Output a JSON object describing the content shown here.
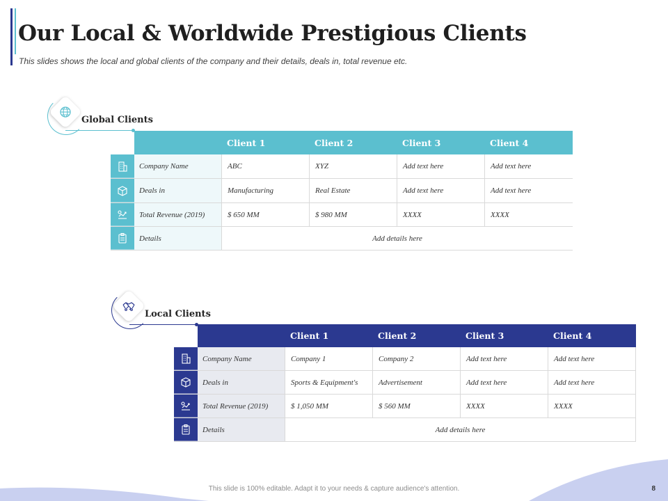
{
  "page": {
    "title": "Our Local  & Worldwide Prestigious Clients",
    "subtitle": "This slides shows  the local and global clients of the company  and their details, deals in, total revenue  etc."
  },
  "colors": {
    "global_accent": "#5bbfcf",
    "global_label_bg": "#eef8fa",
    "local_accent": "#2b3990",
    "local_label_bg": "#e8eaf0"
  },
  "global": {
    "title": "Global Clients",
    "icon": "globe-icon",
    "headers": [
      "Client 1",
      "Client 2",
      "Client 3",
      "Client 4"
    ],
    "rows": [
      {
        "icon": "building-icon",
        "label": "Company Name",
        "values": [
          "ABC",
          "XYZ",
          "Add text here",
          "Add text here"
        ]
      },
      {
        "icon": "box-icon",
        "label": "Deals in",
        "values": [
          "Manufacturing",
          "Real Estate",
          "Add text here",
          "Add text here"
        ]
      },
      {
        "icon": "revenue-chart-icon",
        "label": "Total Revenue  (2019)",
        "values": [
          "$ 650  MM",
          "$ 980  MM",
          "XXXX",
          "XXXX"
        ]
      }
    ],
    "details": {
      "icon": "clipboard-icon",
      "label": "Details",
      "value": "Add details here"
    }
  },
  "local": {
    "title": "Local Clients",
    "icon": "handshake-icon",
    "headers": [
      "Client 1",
      "Client 2",
      "Client 3",
      "Client 4"
    ],
    "rows": [
      {
        "icon": "building-icon",
        "label": "Company Name",
        "values": [
          "Company 1",
          "Company 2",
          "Add text here",
          "Add text here"
        ]
      },
      {
        "icon": "box-icon",
        "label": "Deals in",
        "values": [
          "Sports & Equipment's",
          "Advertisement",
          "Add text here",
          "Add text here"
        ]
      },
      {
        "icon": "revenue-chart-icon",
        "label": "Total Revenue  (2019)",
        "values": [
          "$ 1,050  MM",
          "$ 560  MM",
          "XXXX",
          "XXXX"
        ]
      }
    ],
    "details": {
      "icon": "clipboard-icon",
      "label": "Details",
      "value": "Add details here"
    }
  },
  "footer": {
    "text": "This slide is 100% editable. Adapt it to your needs & capture audience's attention.",
    "page_number": "8"
  }
}
